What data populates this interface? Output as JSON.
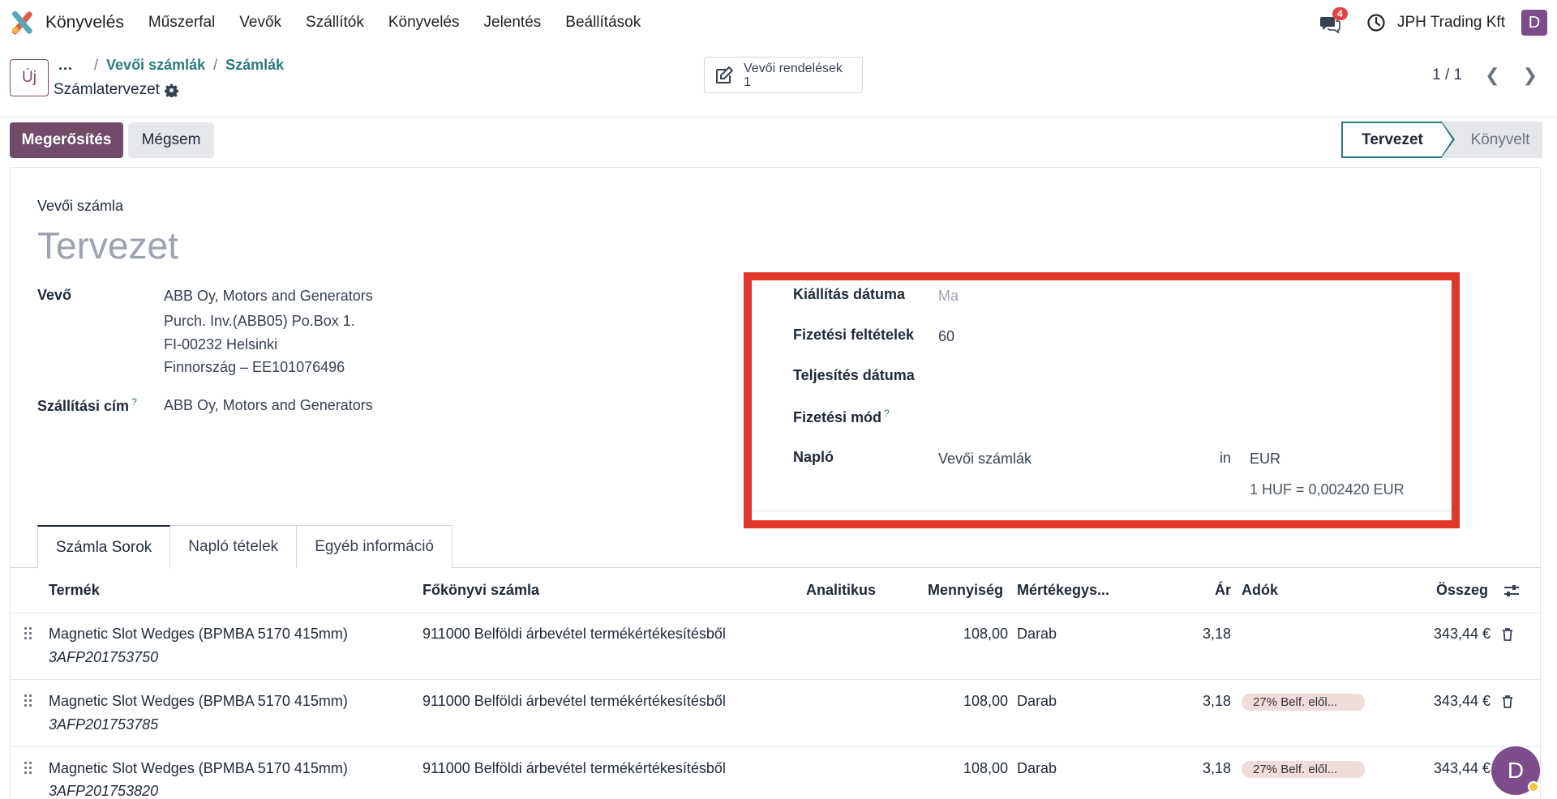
{
  "navbar": {
    "app_name": "Könyvelés",
    "menu": [
      "Műszerfal",
      "Vevők",
      "Szállítók",
      "Könyvelés",
      "Jelentés",
      "Beállítások"
    ],
    "messages_count": "4",
    "company": "JPH Trading Kft",
    "user_initial": "D"
  },
  "control": {
    "new_label": "Új",
    "breadcrumb_dots": "...",
    "breadcrumb": [
      "Vevői számlák",
      "Számlák"
    ],
    "record_name": "Számlatervezet",
    "smart_button_label": "Vevői rendelések",
    "smart_button_count": "1",
    "pager": "1 / 1"
  },
  "actions": {
    "confirm": "Megerősítés",
    "cancel": "Mégsem",
    "status_current": "Tervezet",
    "status_next": "Könyvelt"
  },
  "form": {
    "move_type": "Vevői számla",
    "title": "Tervezet",
    "customer_label": "Vevő",
    "customer_lines": [
      "ABB Oy, Motors and Generators",
      "Purch. Inv.(ABB05) Po.Box 1.",
      "FI-00232 Helsinki",
      "Finnország – EE101076496"
    ],
    "delivery_label": "Szállítási cím",
    "delivery_value": "ABB Oy, Motors and Generators",
    "invoice_date_label": "Kiállítás dátuma",
    "invoice_date_placeholder": "Ma",
    "payment_terms_label": "Fizetési feltételek",
    "payment_terms_value": "60",
    "delivery_date_label": "Teljesítés dátuma",
    "payment_method_label": "Fizetési mód",
    "journal_label": "Napló",
    "journal_value": "Vevői számlák",
    "in_label": "in",
    "currency": "EUR",
    "rate": "1 HUF = 0,002420 EUR"
  },
  "tabs": [
    "Számla Sorok",
    "Napló tételek",
    "Egyéb információ"
  ],
  "table": {
    "headers": {
      "product": "Termék",
      "account": "Főkönyvi számla",
      "analytic": "Analitikus",
      "quantity": "Mennyiség",
      "uom": "Mértékegys...",
      "price": "Ár",
      "taxes": "Adók",
      "amount": "Összeg"
    },
    "rows": [
      {
        "product": "Magnetic Slot Wedges (BPMBA 5170 415mm)",
        "ref": "3AFP201753750",
        "account": "911000 Belföldi árbevétel termékértékesítésből",
        "qty": "108,00",
        "uom": "Darab",
        "price": "3,18",
        "tax": "",
        "amount": "343,44 €"
      },
      {
        "product": "Magnetic Slot Wedges (BPMBA 5170 415mm)",
        "ref": "3AFP201753785",
        "account": "911000 Belföldi árbevétel termékértékesítésből",
        "qty": "108,00",
        "uom": "Darab",
        "price": "3,18",
        "tax": "27% Belf. elől...",
        "amount": "343,44 €"
      },
      {
        "product": "Magnetic Slot Wedges (BPMBA 5170 415mm)",
        "ref": "3AFP201753820",
        "account": "911000 Belföldi árbevétel termékértékesítésből",
        "qty": "108,00",
        "uom": "Darab",
        "price": "3,18",
        "tax": "27% Belf. elől...",
        "amount": "343,44 €"
      }
    ]
  },
  "colors": {
    "brand": "#714b67",
    "link": "#2c7a7b",
    "highlight": "#e0362c"
  }
}
